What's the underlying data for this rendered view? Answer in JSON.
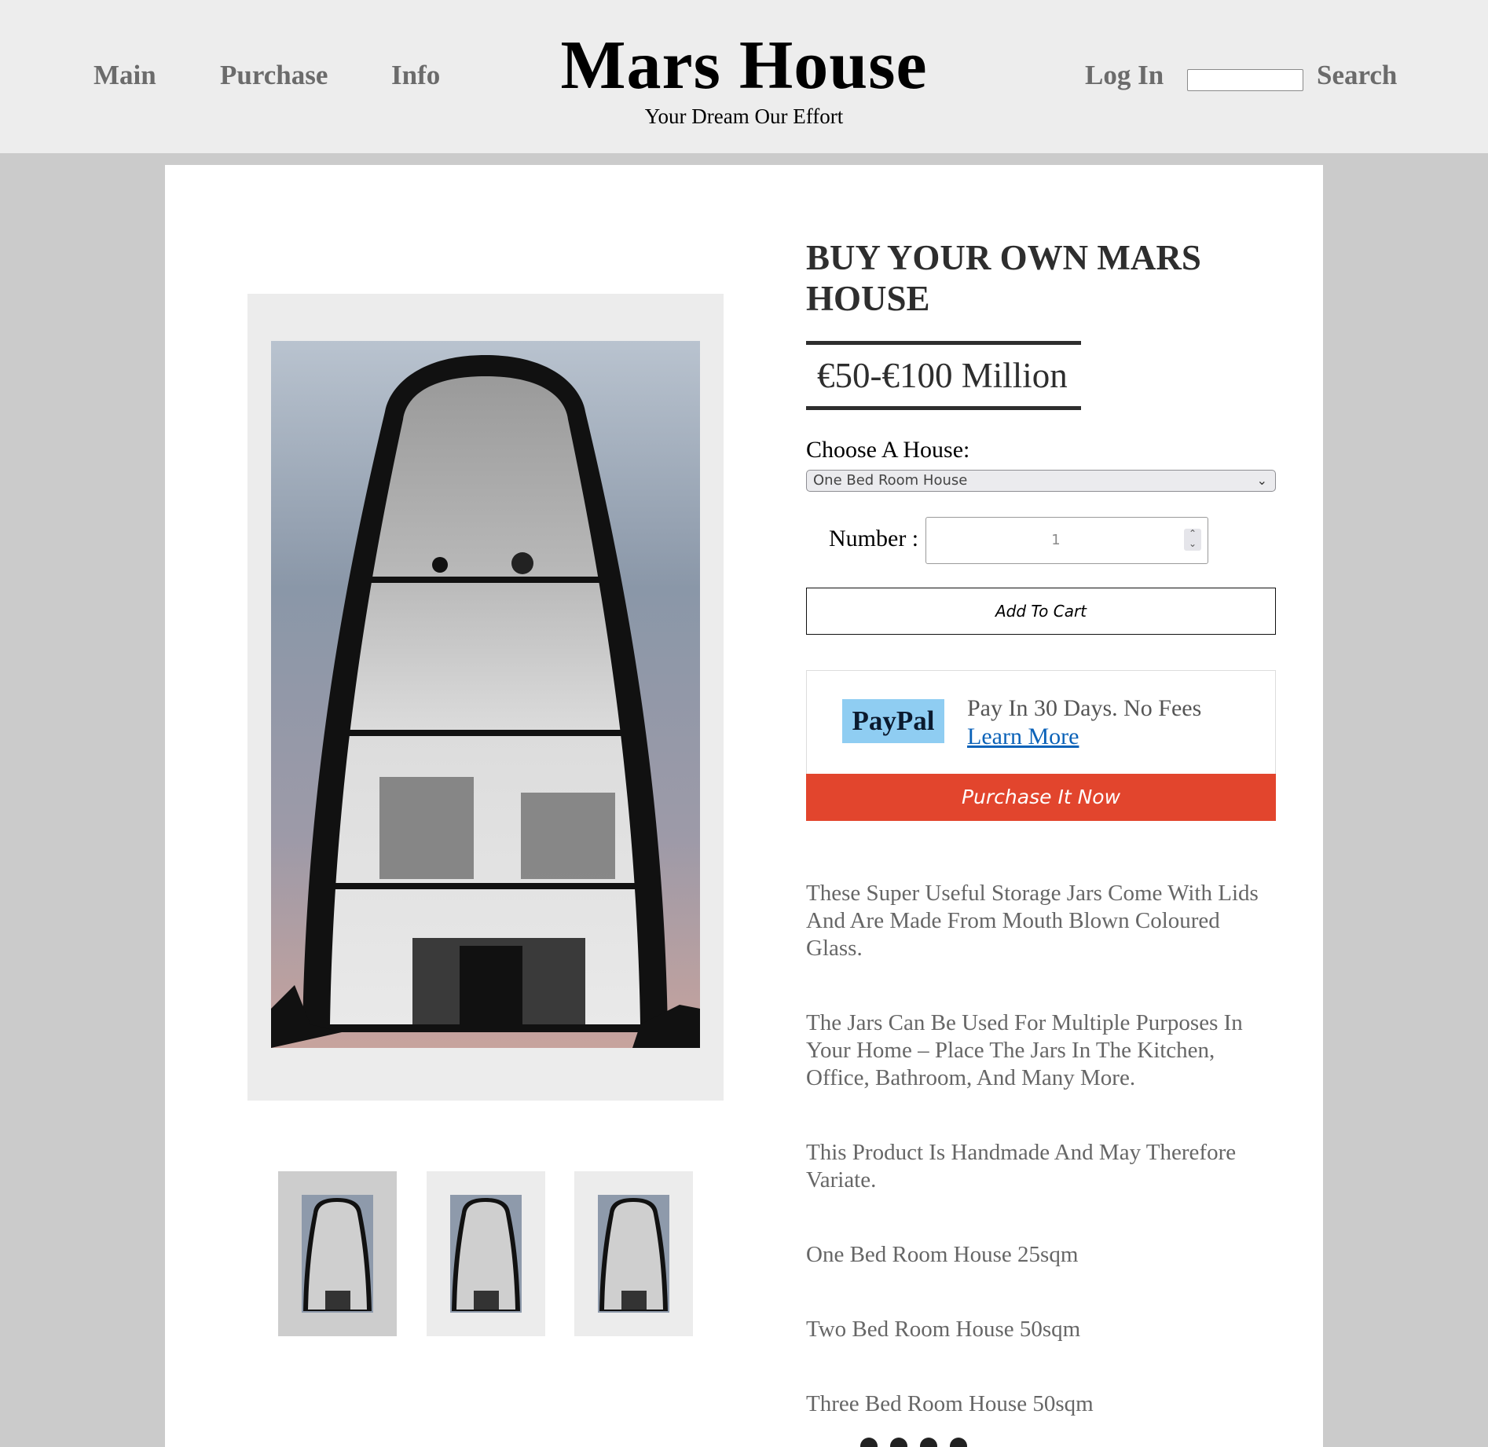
{
  "nav": {
    "main": "Main",
    "purchase": "Purchase",
    "info": "Info",
    "login": "Log In",
    "search": "Search"
  },
  "brand": {
    "title": "Mars House",
    "tagline": "Your Dream Our Effort"
  },
  "product": {
    "title": "BUY YOUR OWN MARS HOUSE",
    "price": "€50-€100 Million",
    "choose_label": "Choose A House:",
    "selected_house": "One Bed Room House",
    "number_label": "Number :",
    "number_value": "1",
    "add_to_cart": "Add To Cart",
    "paypal": {
      "logo": "PayPal",
      "text": "Pay In 30 Days. No Fees",
      "link": "Learn More"
    },
    "purchase_now": "Purchase It Now",
    "descriptions": [
      "These Super Useful Storage Jars Come With Lids And Are Made From Mouth Blown Coloured Glass.",
      "The Jars Can Be Used For Multiple Purposes In Your Home – Place The Jars In The Kitchen, Office, Bathroom, And Many More.",
      "This Product Is Handmade And May Therefore Variate.",
      "One Bed Room House 25sqm",
      "Two Bed Room House 50sqm",
      "Three Bed Room House 50sqm"
    ]
  },
  "colors": {
    "header_bg": "#ededed",
    "page_bg": "#cbcbcb",
    "purchase_button": "#e2452d",
    "paypal_logo_bg": "#8fcdf2",
    "link": "#0b62b8"
  },
  "icons": [
    "chevron-down-icon",
    "spinner-arrows-icon",
    "twitter-icon",
    "facebook-icon",
    "instagram-icon",
    "pinterest-icon"
  ]
}
